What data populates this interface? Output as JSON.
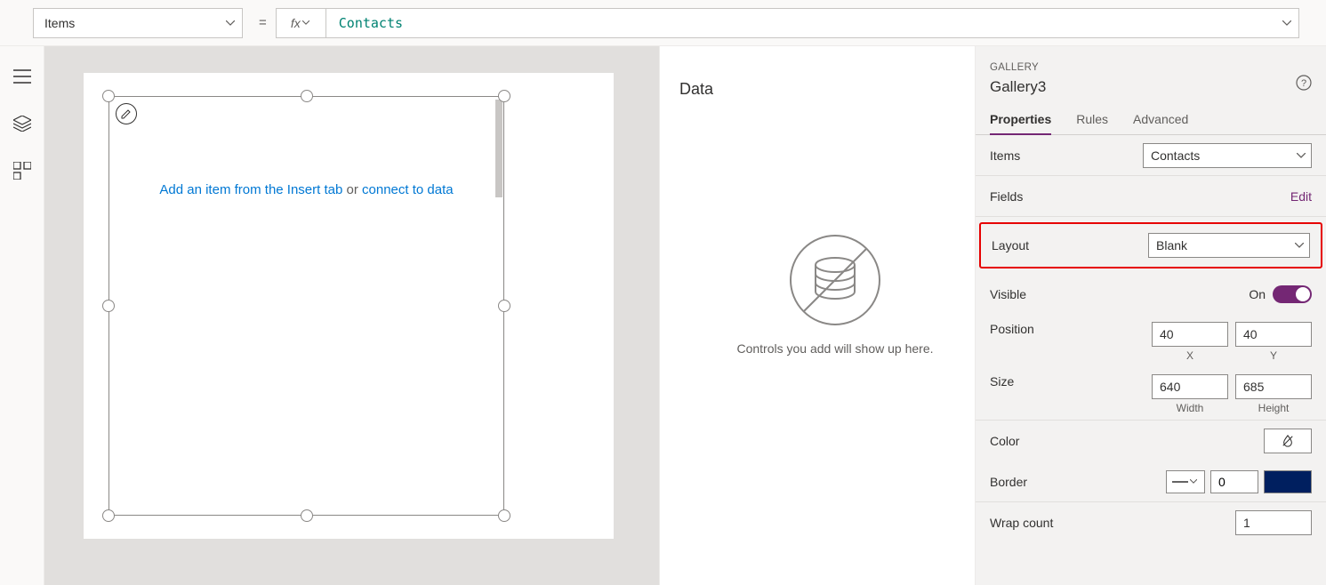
{
  "formula_bar": {
    "property": "Items",
    "value": "Contacts"
  },
  "canvas": {
    "hint_before": "Add an item from the Insert tab",
    "hint_or": " or ",
    "hint_link": "connect to data"
  },
  "data_panel": {
    "title": "Data",
    "empty_text": "Controls you add will show up here."
  },
  "props": {
    "kind": "GALLERY",
    "name": "Gallery3",
    "tabs": {
      "properties": "Properties",
      "rules": "Rules",
      "advanced": "Advanced"
    },
    "items_label": "Items",
    "items_value": "Contacts",
    "fields_label": "Fields",
    "fields_edit": "Edit",
    "layout_label": "Layout",
    "layout_value": "Blank",
    "visible_label": "Visible",
    "visible_value": "On",
    "position_label": "Position",
    "x": "40",
    "x_label": "X",
    "y": "40",
    "y_label": "Y",
    "size_label": "Size",
    "width": "640",
    "width_label": "Width",
    "height": "685",
    "height_label": "Height",
    "color_label": "Color",
    "border_label": "Border",
    "border_width": "0",
    "wrap_label": "Wrap count",
    "wrap_value": "1"
  }
}
